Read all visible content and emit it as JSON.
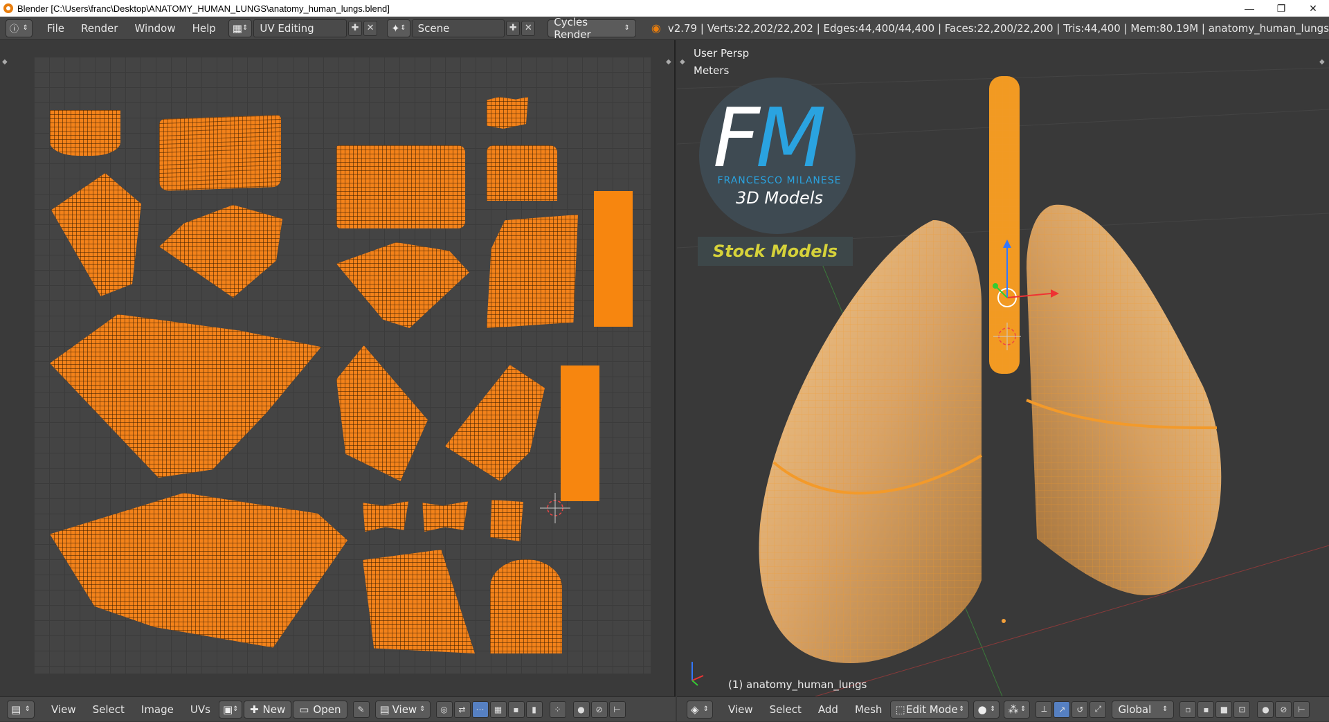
{
  "window": {
    "title": "Blender [C:\\Users\\franc\\Desktop\\ANATOMY_HUMAN_LUNGS\\anatomy_human_lungs.blend]",
    "minimize": "—",
    "maximize": "❐",
    "close": "✕"
  },
  "topbar": {
    "menus": [
      "File",
      "Render",
      "Window",
      "Help"
    ],
    "layout": "UV Editing",
    "scene": "Scene",
    "engine": "Cycles Render",
    "stats": "v2.79 | Verts:22,202/22,202 | Edges:44,400/44,400 | Faces:22,200/22,200 | Tris:44,400 | Mem:80.19M | anatomy_human_lungs"
  },
  "uv_editor": {
    "menus": [
      "View",
      "Select",
      "Image",
      "UVs"
    ],
    "new_label": "New",
    "open_label": "Open",
    "view_label": "View"
  },
  "viewport": {
    "view_name": "User Persp",
    "units": "Meters",
    "object_label": "(1) anatomy_human_lungs",
    "menus": [
      "View",
      "Select",
      "Add",
      "Mesh"
    ],
    "mode": "Edit Mode",
    "orientation": "Global"
  },
  "logo": {
    "letter_f": "F",
    "letter_m": "M",
    "name": "FRANCESCO MILANESE",
    "sub": "3D Models",
    "badge": "Stock Models"
  },
  "colors": {
    "uv_orange": "#f3821a",
    "accent_blue": "#2aa3e0",
    "badge_yellow": "#d6d23a"
  }
}
